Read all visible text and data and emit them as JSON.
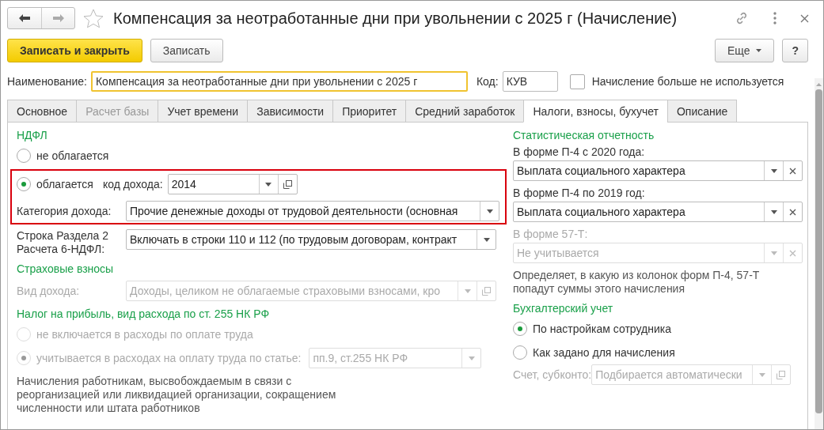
{
  "window": {
    "title": "Компенсация за неотработанные дни при увольнении с 2025 г (Начисление)",
    "favorite": false
  },
  "toolbar": {
    "buttons": [
      {
        "label": "Записать и закрыть",
        "kind": "primary"
      },
      {
        "label": "Записать",
        "kind": "default"
      }
    ],
    "more": "Еще",
    "help": "?"
  },
  "header": {
    "name_label": "Наименование:",
    "name_value": "Компенсация за неотработанные дни при увольнении с 2025 г",
    "code_label": "Код:",
    "code_value": "КУВ",
    "unused": {
      "label": "Начисление больше не используется",
      "checked": false
    }
  },
  "tabs": [
    {
      "label": "Основное",
      "selected": false,
      "disabled": false
    },
    {
      "label": "Расчет базы",
      "selected": false,
      "disabled": true
    },
    {
      "label": "Учет времени",
      "selected": false,
      "disabled": false
    },
    {
      "label": "Зависимости",
      "selected": false,
      "disabled": false
    },
    {
      "label": "Приоритет",
      "selected": false,
      "disabled": false
    },
    {
      "label": "Средний заработок",
      "selected": false,
      "disabled": false
    },
    {
      "label": "Налоги, взносы, бухучет",
      "selected": true,
      "disabled": false
    },
    {
      "label": "Описание",
      "selected": false,
      "disabled": false
    }
  ],
  "ndfl": {
    "heading": "НДФЛ",
    "options": [
      {
        "label": "не облагается",
        "selected": false
      },
      {
        "label": "облагается",
        "selected": true
      }
    ],
    "income_code": {
      "label": "код дохода:",
      "value": "2014",
      "disabled": false,
      "dropdown": true,
      "open": true
    },
    "category": {
      "label": "Категория дохода:",
      "value": "Прочие денежные доходы от трудовой деятельности (основная",
      "disabled": false,
      "dropdown": true
    },
    "report_line": {
      "label": "Строка Раздела 2 Расчета 6-НДФЛ:",
      "value": "Включать в строки 110 и 112 (по трудовым договорам, контракт",
      "disabled": false,
      "dropdown": true
    }
  },
  "insurance": {
    "heading": "Страховые взносы",
    "income_type": {
      "label": "Вид дохода:",
      "value": "Доходы, целиком не облагаемые страховыми взносами, кро",
      "disabled": true,
      "dropdown": true,
      "open": true
    }
  },
  "profit_tax": {
    "heading": "Налог на прибыль, вид расхода по ст. 255 НК РФ",
    "options": [
      {
        "label": "не включается в расходы по оплате труда",
        "selected": false,
        "disabled": true
      },
      {
        "label": "учитывается в расходах на оплату труда по статье:",
        "selected": true,
        "disabled": true
      }
    ],
    "article": {
      "value": "пп.9, ст.255 НК РФ",
      "disabled": true,
      "dropdown": true
    },
    "note": "Начисления работникам, высвобождаемым в связи с реорганизацией или ликвидацией организации, сокращением численности или штата работников"
  },
  "statistics": {
    "heading": "Статистическая отчетность",
    "forms": [
      {
        "label": "В форме П-4 с 2020 года:",
        "value": "Выплата социального характера",
        "disabled": false,
        "dropdown": true,
        "clear": true
      },
      {
        "label": "В форме П-4 по 2019 год:",
        "value": "Выплата социального характера",
        "disabled": false,
        "dropdown": true,
        "clear": true
      },
      {
        "label": "В форме 57-Т:",
        "value": "Не учитывается",
        "disabled": true,
        "dropdown": true,
        "clear": true
      }
    ],
    "note": "Определяет, в какую из колонок форм П-4, 57-Т попадут суммы этого начисления"
  },
  "accounting": {
    "heading": "Бухгалтерский учет",
    "options": [
      {
        "label": "По настройкам сотрудника",
        "selected": true
      },
      {
        "label": "Как задано для начисления",
        "selected": false
      }
    ],
    "account": {
      "label": "Счет, субконто:",
      "value": "Подбирается автоматически",
      "disabled": true,
      "dropdown": true,
      "open": true
    }
  }
}
